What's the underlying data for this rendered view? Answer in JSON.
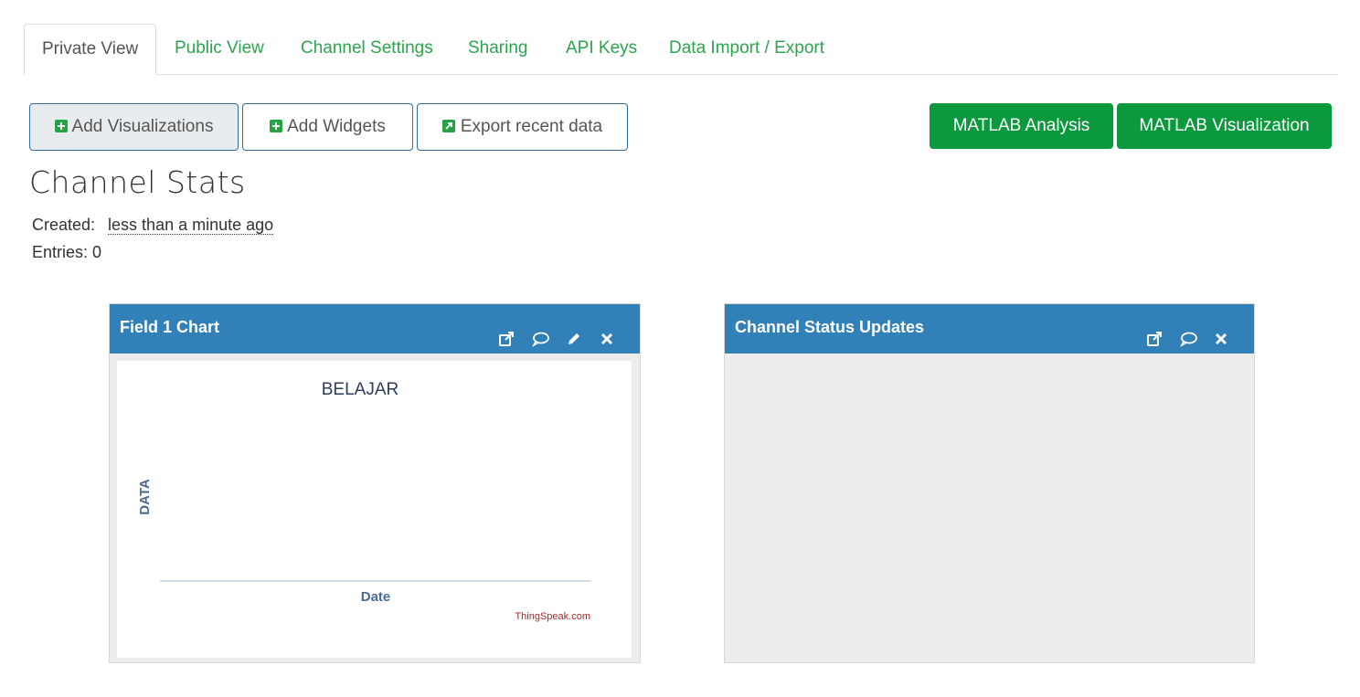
{
  "tabs": [
    {
      "label": "Private View",
      "active": true
    },
    {
      "label": "Public View"
    },
    {
      "label": "Channel Settings"
    },
    {
      "label": "Sharing"
    },
    {
      "label": "API Keys"
    },
    {
      "label": "Data Import / Export"
    }
  ],
  "actions": {
    "add_visualizations": "Add Visualizations",
    "add_widgets": "Add Widgets",
    "export_recent": "Export recent data",
    "matlab_analysis": "MATLAB Analysis",
    "matlab_visualization": "MATLAB Visualization"
  },
  "stats": {
    "title": "Channel Stats",
    "created_label": "Created:",
    "created_value": "less than a minute ago",
    "entries_text": "Entries: 0"
  },
  "panels": {
    "field_chart": {
      "title": "Field 1 Chart",
      "icons": [
        "external-link-icon",
        "comment-icon",
        "edit-icon",
        "close-icon"
      ]
    },
    "status_updates": {
      "title": "Channel Status Updates",
      "icons": [
        "external-link-icon",
        "comment-icon",
        "close-icon"
      ]
    }
  },
  "chart_data": {
    "type": "line",
    "title": "BELAJAR",
    "xlabel": "Date",
    "ylabel": "DATA",
    "series": [],
    "credit": "ThingSpeak.com",
    "grid": false
  },
  "colors": {
    "accent_green": "#0a9a3d",
    "tab_green": "#2da44e",
    "panel_header": "#3180b7",
    "credit_red": "#b22222"
  }
}
